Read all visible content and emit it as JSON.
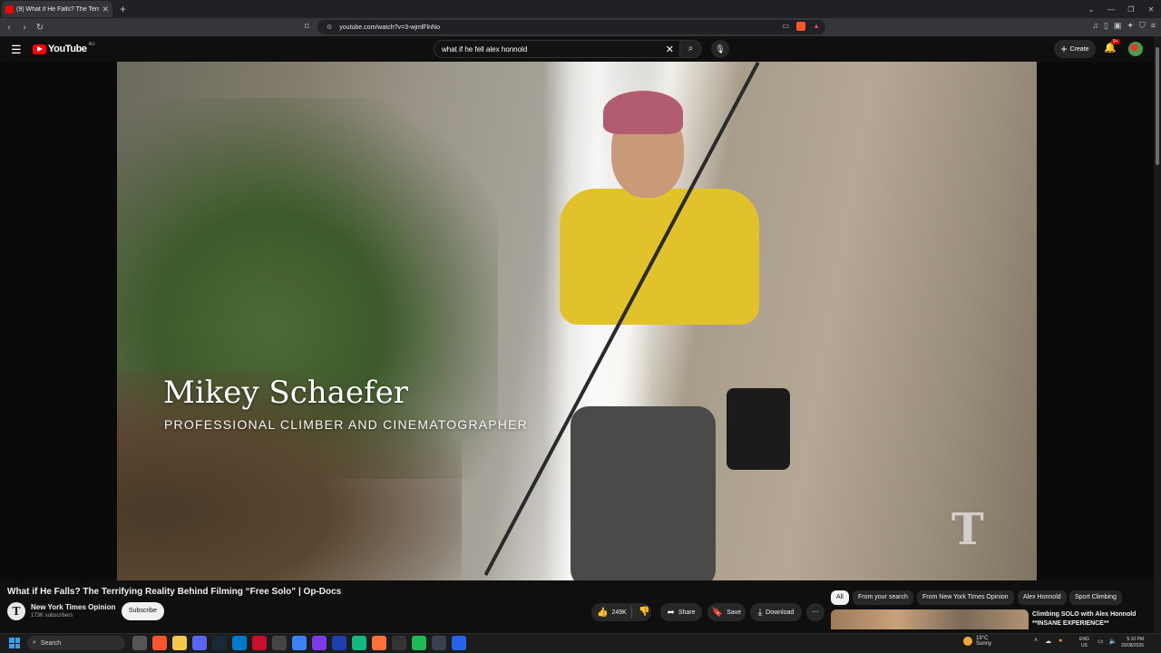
{
  "browser": {
    "tab_title": "(9) What if He Falls? The Terri",
    "url": "youtube.com/watch?v=3-wjmlFlnNo"
  },
  "masthead": {
    "logo_text": "YouTube",
    "country_code": "AU",
    "search_value": "what if he fell alex honnold",
    "create_label": "Create",
    "notification_count": "9+"
  },
  "video": {
    "lower_third_name": "Mikey Schaefer",
    "lower_third_role": "PROFESSIONAL CLIMBER AND CINEMATOGRAPHER",
    "watermark": "T"
  },
  "info": {
    "title": "What if He Falls? The Terrifying Reality Behind Filming “Free Solo” | Op-Docs",
    "channel_initial": "T",
    "channel_name": "New York Times Opinion",
    "subscribers": "173K subscribers",
    "subscribe_label": "Subscribe",
    "likes": "249K",
    "share_label": "Share",
    "save_label": "Save",
    "download_label": "Download",
    "more_label": "⋯"
  },
  "chips": [
    "All",
    "From your search",
    "From New York Times Opinion",
    "Alex Honnold",
    "Sport Climbing"
  ],
  "recommendation": {
    "title": "Climbing SOLO with Alex Honnold **INSANE EXPERIENCE**"
  },
  "taskbar": {
    "search_label": "Search",
    "weather_temp": "19°C",
    "weather_desc": "Sunny",
    "lang_top": "ENG",
    "lang_bottom": "US",
    "time": "5:10 PM",
    "date": "20/08/2026"
  },
  "colors": {
    "accent": "#ff0000",
    "background": "#0f0f0f"
  }
}
